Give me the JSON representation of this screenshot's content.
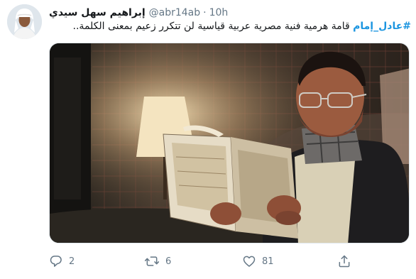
{
  "tweet": {
    "author": {
      "display_name": "إبراهيم سهل سيدي",
      "handle": "@abr14ab",
      "time": "10h",
      "separator": "·"
    },
    "text": {
      "hashtag": "#عادل_إمام",
      "body": " قامة هرمية فنية مصرية عربية قياسية لن تتكرر زعيم بمعنى الكلمة.."
    },
    "media": {
      "kind": "photo"
    },
    "actions": {
      "reply_count": "2",
      "retweet_count": "6",
      "like_count": "81"
    },
    "icons": {
      "reply": "reply-icon",
      "retweet": "retweet-icon",
      "like": "heart-icon",
      "share": "share-icon"
    },
    "colors": {
      "hashtag": "#1b95e0",
      "secondary_text": "#657786",
      "primary_text": "#14171a"
    }
  }
}
